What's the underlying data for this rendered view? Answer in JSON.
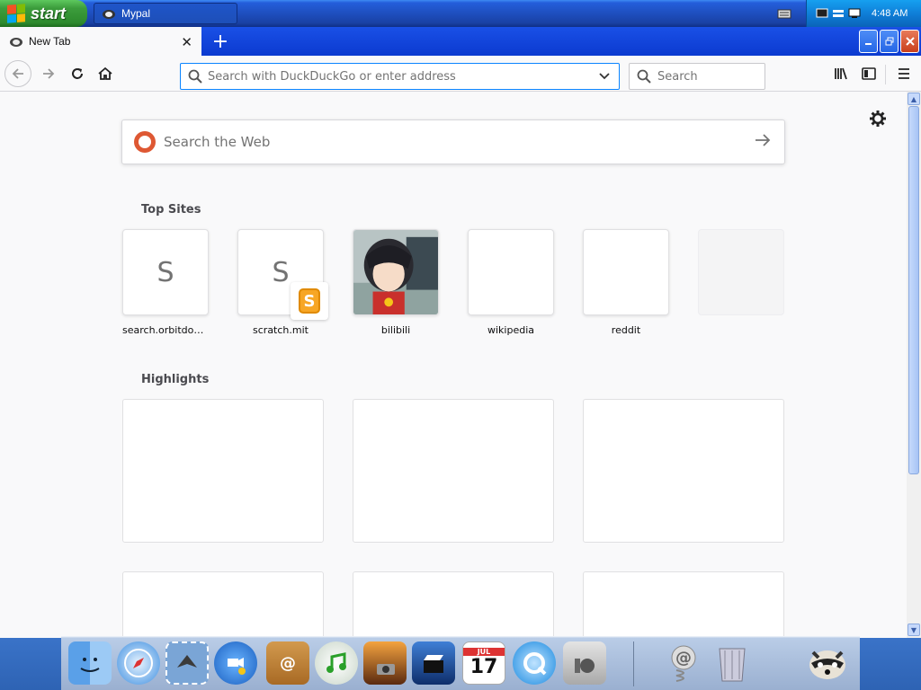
{
  "taskbar": {
    "start_label": "start",
    "task_label": "Mypal",
    "clock": "4:48 AM"
  },
  "browser": {
    "tab_title": "New Tab",
    "newtab_symbol": "+",
    "url_placeholder": "Search with DuckDuckGo or enter address",
    "search_placeholder": "Search"
  },
  "newtab": {
    "web_search_placeholder": "Search the Web",
    "top_sites_title": "Top Sites",
    "highlights_title": "Highlights",
    "top_sites": [
      {
        "label": "search.orbitdownl...",
        "letter": "S"
      },
      {
        "label": "scratch.mit",
        "letter": "S"
      },
      {
        "label": "bilibili",
        "letter": ""
      },
      {
        "label": "wikipedia",
        "letter": ""
      },
      {
        "label": "reddit",
        "letter": ""
      },
      {
        "label": "",
        "letter": ""
      }
    ]
  },
  "colors": {
    "accent": "#0a84ff",
    "tabstrip": "#0b3ad0",
    "ddg": "#de5833",
    "scratch": "#f7a625"
  },
  "dock": {
    "icons": [
      "finder-icon",
      "safari-icon",
      "mail-stamp-icon",
      "ichat-icon",
      "address-book-icon",
      "itunes-icon",
      "iphoto-icon",
      "imovie-icon",
      "ical-icon",
      "quicktime-icon",
      "system-preferences-icon",
      "mail-icon",
      "trash-icon",
      "raccoon-icon"
    ],
    "ical_month": "JUL",
    "ical_day": "17"
  }
}
